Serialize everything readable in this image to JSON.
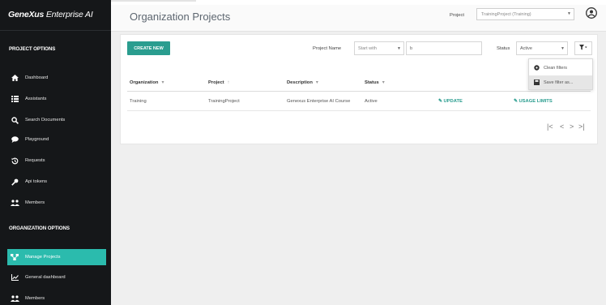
{
  "brand": {
    "name_bold": "GeneXus",
    "name_rest": " Enterprise AI"
  },
  "sidebar": {
    "project_options_title": "PROJECT OPTIONS",
    "project_items": [
      {
        "label": "Dashboard",
        "icon": "home-icon"
      },
      {
        "label": "Assistants",
        "icon": "list-icon"
      },
      {
        "label": "Search Documents",
        "icon": "search-icon"
      },
      {
        "label": "Playground",
        "icon": "chat-icon"
      },
      {
        "label": "Requests",
        "icon": "history-icon"
      },
      {
        "label": "Api tokens",
        "icon": "key-icon"
      },
      {
        "label": "Members",
        "icon": "members-icon"
      }
    ],
    "org_options_title": "ORGANIZATION OPTIONS",
    "org_items": [
      {
        "label": "Manage Projects",
        "icon": "projects-icon",
        "active": true
      },
      {
        "label": "General dashboard",
        "icon": "chart-icon"
      },
      {
        "label": "Members",
        "icon": "members-icon"
      }
    ]
  },
  "header": {
    "title": "Organization Projects",
    "project_label": "Project",
    "project_value": "TrainingProject (Training)"
  },
  "toolbar": {
    "create_label": "CREATE NEW",
    "project_name_label": "Project Name",
    "match_mode": "Start with",
    "search_value": "b",
    "status_label": "Status",
    "status_value": "Active"
  },
  "filter_menu": {
    "items": [
      {
        "label": "Clean filters",
        "icon": "gear-icon"
      },
      {
        "label": "Save filter as...",
        "icon": "save-icon"
      }
    ]
  },
  "table": {
    "columns": [
      "Organization",
      "Project",
      "Description",
      "Status"
    ],
    "rows": [
      {
        "organization": "Training",
        "project": "TrainingProject",
        "description": "Genexus Enterprise AI Course",
        "status": "Active",
        "update_label": "UPDATE",
        "usage_label": "USAGE LIMITS"
      }
    ]
  },
  "pagination": {
    "first": "|<",
    "prev": "<",
    "next": ">",
    "last": ">|"
  },
  "colors": {
    "sidebar_bg": "#151719",
    "accent": "#2a9d8f",
    "active_item": "#2bbbad",
    "content_bg": "#efefef"
  }
}
